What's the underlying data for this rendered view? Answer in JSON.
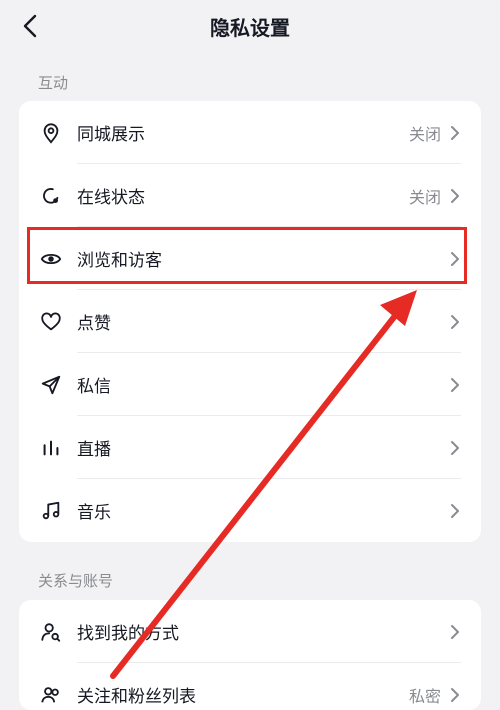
{
  "header": {
    "title": "隐私设置",
    "back_icon": "chevron-left-icon"
  },
  "sections": [
    {
      "title": "互动",
      "items": [
        {
          "label": "同城展示",
          "value": "关闭",
          "icon": "location-pin-icon"
        },
        {
          "label": "在线状态",
          "value": "关闭",
          "icon": "online-status-icon"
        },
        {
          "label": "浏览和访客",
          "value": "",
          "icon": "eye-icon",
          "highlighted": true
        },
        {
          "label": "点赞",
          "value": "",
          "icon": "heart-icon"
        },
        {
          "label": "私信",
          "value": "",
          "icon": "send-icon"
        },
        {
          "label": "直播",
          "value": "",
          "icon": "live-bars-icon"
        },
        {
          "label": "音乐",
          "value": "",
          "icon": "music-note-icon"
        }
      ]
    },
    {
      "title": "关系与账号",
      "items": [
        {
          "label": "找到我的方式",
          "value": "",
          "icon": "person-search-icon"
        },
        {
          "label": "关注和粉丝列表",
          "value": "私密",
          "icon": "people-icon"
        }
      ]
    }
  ],
  "annotation": {
    "highlight_color": "#e62a24",
    "arrow_color": "#e62a24"
  },
  "colors": {
    "background": "#f2f2f4",
    "card": "#ffffff",
    "text_primary": "#161823",
    "text_secondary": "#8a8b91"
  }
}
